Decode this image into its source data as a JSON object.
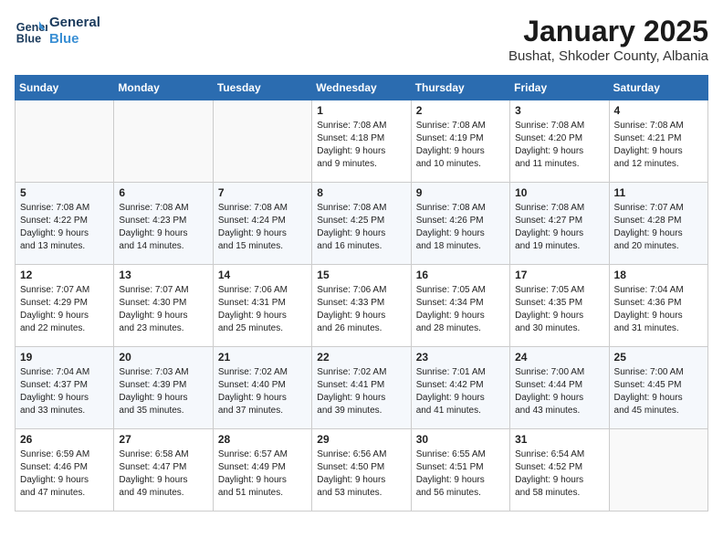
{
  "header": {
    "logo_line1": "General",
    "logo_line2": "Blue",
    "month": "January 2025",
    "location": "Bushat, Shkoder County, Albania"
  },
  "weekdays": [
    "Sunday",
    "Monday",
    "Tuesday",
    "Wednesday",
    "Thursday",
    "Friday",
    "Saturday"
  ],
  "weeks": [
    [
      {
        "day": "",
        "content": ""
      },
      {
        "day": "",
        "content": ""
      },
      {
        "day": "",
        "content": ""
      },
      {
        "day": "1",
        "content": "Sunrise: 7:08 AM\nSunset: 4:18 PM\nDaylight: 9 hours\nand 9 minutes."
      },
      {
        "day": "2",
        "content": "Sunrise: 7:08 AM\nSunset: 4:19 PM\nDaylight: 9 hours\nand 10 minutes."
      },
      {
        "day": "3",
        "content": "Sunrise: 7:08 AM\nSunset: 4:20 PM\nDaylight: 9 hours\nand 11 minutes."
      },
      {
        "day": "4",
        "content": "Sunrise: 7:08 AM\nSunset: 4:21 PM\nDaylight: 9 hours\nand 12 minutes."
      }
    ],
    [
      {
        "day": "5",
        "content": "Sunrise: 7:08 AM\nSunset: 4:22 PM\nDaylight: 9 hours\nand 13 minutes."
      },
      {
        "day": "6",
        "content": "Sunrise: 7:08 AM\nSunset: 4:23 PM\nDaylight: 9 hours\nand 14 minutes."
      },
      {
        "day": "7",
        "content": "Sunrise: 7:08 AM\nSunset: 4:24 PM\nDaylight: 9 hours\nand 15 minutes."
      },
      {
        "day": "8",
        "content": "Sunrise: 7:08 AM\nSunset: 4:25 PM\nDaylight: 9 hours\nand 16 minutes."
      },
      {
        "day": "9",
        "content": "Sunrise: 7:08 AM\nSunset: 4:26 PM\nDaylight: 9 hours\nand 18 minutes."
      },
      {
        "day": "10",
        "content": "Sunrise: 7:08 AM\nSunset: 4:27 PM\nDaylight: 9 hours\nand 19 minutes."
      },
      {
        "day": "11",
        "content": "Sunrise: 7:07 AM\nSunset: 4:28 PM\nDaylight: 9 hours\nand 20 minutes."
      }
    ],
    [
      {
        "day": "12",
        "content": "Sunrise: 7:07 AM\nSunset: 4:29 PM\nDaylight: 9 hours\nand 22 minutes."
      },
      {
        "day": "13",
        "content": "Sunrise: 7:07 AM\nSunset: 4:30 PM\nDaylight: 9 hours\nand 23 minutes."
      },
      {
        "day": "14",
        "content": "Sunrise: 7:06 AM\nSunset: 4:31 PM\nDaylight: 9 hours\nand 25 minutes."
      },
      {
        "day": "15",
        "content": "Sunrise: 7:06 AM\nSunset: 4:33 PM\nDaylight: 9 hours\nand 26 minutes."
      },
      {
        "day": "16",
        "content": "Sunrise: 7:05 AM\nSunset: 4:34 PM\nDaylight: 9 hours\nand 28 minutes."
      },
      {
        "day": "17",
        "content": "Sunrise: 7:05 AM\nSunset: 4:35 PM\nDaylight: 9 hours\nand 30 minutes."
      },
      {
        "day": "18",
        "content": "Sunrise: 7:04 AM\nSunset: 4:36 PM\nDaylight: 9 hours\nand 31 minutes."
      }
    ],
    [
      {
        "day": "19",
        "content": "Sunrise: 7:04 AM\nSunset: 4:37 PM\nDaylight: 9 hours\nand 33 minutes."
      },
      {
        "day": "20",
        "content": "Sunrise: 7:03 AM\nSunset: 4:39 PM\nDaylight: 9 hours\nand 35 minutes."
      },
      {
        "day": "21",
        "content": "Sunrise: 7:02 AM\nSunset: 4:40 PM\nDaylight: 9 hours\nand 37 minutes."
      },
      {
        "day": "22",
        "content": "Sunrise: 7:02 AM\nSunset: 4:41 PM\nDaylight: 9 hours\nand 39 minutes."
      },
      {
        "day": "23",
        "content": "Sunrise: 7:01 AM\nSunset: 4:42 PM\nDaylight: 9 hours\nand 41 minutes."
      },
      {
        "day": "24",
        "content": "Sunrise: 7:00 AM\nSunset: 4:44 PM\nDaylight: 9 hours\nand 43 minutes."
      },
      {
        "day": "25",
        "content": "Sunrise: 7:00 AM\nSunset: 4:45 PM\nDaylight: 9 hours\nand 45 minutes."
      }
    ],
    [
      {
        "day": "26",
        "content": "Sunrise: 6:59 AM\nSunset: 4:46 PM\nDaylight: 9 hours\nand 47 minutes."
      },
      {
        "day": "27",
        "content": "Sunrise: 6:58 AM\nSunset: 4:47 PM\nDaylight: 9 hours\nand 49 minutes."
      },
      {
        "day": "28",
        "content": "Sunrise: 6:57 AM\nSunset: 4:49 PM\nDaylight: 9 hours\nand 51 minutes."
      },
      {
        "day": "29",
        "content": "Sunrise: 6:56 AM\nSunset: 4:50 PM\nDaylight: 9 hours\nand 53 minutes."
      },
      {
        "day": "30",
        "content": "Sunrise: 6:55 AM\nSunset: 4:51 PM\nDaylight: 9 hours\nand 56 minutes."
      },
      {
        "day": "31",
        "content": "Sunrise: 6:54 AM\nSunset: 4:52 PM\nDaylight: 9 hours\nand 58 minutes."
      },
      {
        "day": "",
        "content": ""
      }
    ]
  ]
}
